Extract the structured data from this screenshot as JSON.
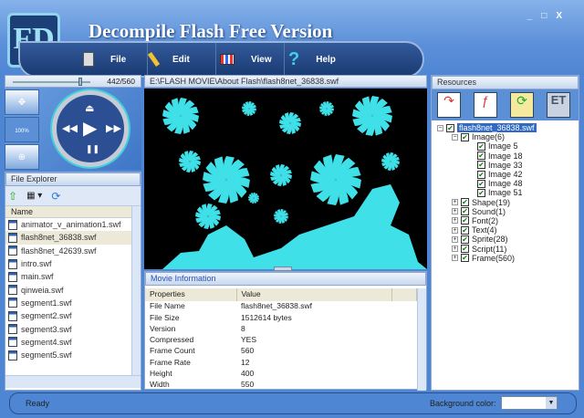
{
  "app": {
    "title": "Decompile Flash  Free Version",
    "window_controls": [
      "_",
      "□",
      "X"
    ],
    "logo_text": "FD"
  },
  "menu": [
    {
      "label": "File",
      "icon": "file-icon"
    },
    {
      "label": "Edit",
      "icon": "pencil-icon"
    },
    {
      "label": "View",
      "icon": "view-grid-icon"
    },
    {
      "label": "Help",
      "icon": "help-question-icon"
    }
  ],
  "player": {
    "frame_label": "442/560",
    "current_frame": 442,
    "total_frames": 560,
    "zoom_buttons": [
      "zoom-move-icon",
      "zoom-100-icon",
      "zoom-fit-icon"
    ],
    "zoom_100_text": "100%"
  },
  "file_explorer": {
    "title": "File Explorer",
    "column": "Name",
    "selected": "flash8net_36838.swf",
    "files": [
      "animator_v_animation1.swf",
      "flash8net_36838.swf",
      "flash8net_42639.swf",
      "intro.swf",
      "main.swf",
      "qinweia.swf",
      "segment1.swf",
      "segment2.swf",
      "segment3.swf",
      "segment4.swf",
      "segment5.swf"
    ]
  },
  "path": "E:\\FLASH MOVIE\\About Flash\\flash8net_36838.swf",
  "movie_info": {
    "title": "Movie Information",
    "columns": [
      "Properties",
      "Value"
    ],
    "rows": [
      [
        "File Name",
        "flash8net_36838.swf"
      ],
      [
        "File Size",
        "1512614 bytes"
      ],
      [
        "Version",
        "8"
      ],
      [
        "Compressed",
        "YES"
      ],
      [
        "Frame Count",
        "560"
      ],
      [
        "Frame Rate",
        "12"
      ],
      [
        "Height",
        "400"
      ],
      [
        "Width",
        "550"
      ]
    ]
  },
  "resources": {
    "title": "Resources",
    "root": "flash8net_36838.swf",
    "image_group": "Image(6)",
    "images": [
      "Image 5",
      "Image 18",
      "Image 33",
      "Image 42",
      "Image 48",
      "Image 51"
    ],
    "groups": [
      "Shape(19)",
      "Sound(1)",
      "Font(2)",
      "Text(4)",
      "Sprite(28)",
      "Script(11)",
      "Frame(560)"
    ]
  },
  "status": {
    "text": "Ready",
    "bg_label": "Background color:",
    "bg_value": "#ffffff"
  },
  "colors": {
    "accent": "#4f86d4",
    "stage_art": "#3fe0e8"
  }
}
